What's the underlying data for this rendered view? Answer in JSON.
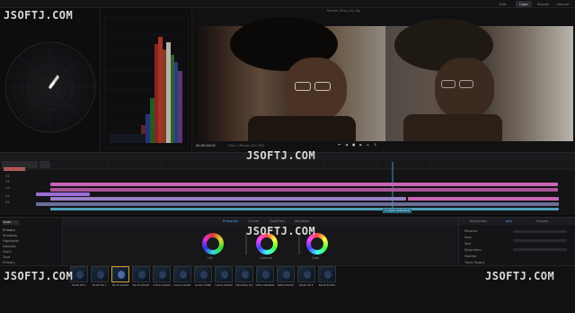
{
  "app": {
    "watermark": "JSOFTJ.COM",
    "pages": [
      "Media",
      "Edit",
      "Color",
      "Render",
      "Deliver"
    ],
    "active_page": "Color"
  },
  "viewer": {
    "clip_label": "Marbie_Silva_04_clip",
    "timecode": "00:00:24:02",
    "zoom_label": "Clip 1",
    "info": "Clip 1 (Prores 422 HQ)"
  },
  "timeline": {
    "track_labels": [
      "V1",
      "V2",
      "V3",
      "A1",
      "A2"
    ],
    "status": "2 clips selected"
  },
  "colorpanel": {
    "tabs": [
      "Primaries",
      "Curves",
      "Qualifiers",
      "Windows"
    ],
    "active_tab": "Primaries",
    "wheel_modes": [
      "Lift",
      "Gamma",
      "Gain"
    ],
    "node_list": [
      "Primary",
      "Shadows",
      "Highlights",
      "Denoise",
      "Grain",
      "Tone",
      "Primary",
      "Output"
    ],
    "right_tabs": [
      "Keyframes",
      "Info",
      "Scopes"
    ],
    "right_active": "Info",
    "right_fields": [
      "Reverse",
      "Solo",
      "Size",
      "Saturation",
      "Feather",
      "Track Object"
    ]
  },
  "thumbnails": [
    {
      "label": "NOIR PN 1"
    },
    {
      "label": "BLUE ED 1"
    },
    {
      "label": "BLUE WARM"
    },
    {
      "label": "BLUE MOVIE"
    },
    {
      "label": "GOLD WARM"
    },
    {
      "label": "GOLD SPORT"
    },
    {
      "label": "GOLD TONE"
    },
    {
      "label": "GOLD WARM"
    },
    {
      "label": "NEUTRAL ED"
    },
    {
      "label": "NEW ORANGE"
    },
    {
      "label": "NEW MOVIE"
    },
    {
      "label": "NOIR PN 2"
    },
    {
      "label": "BLUE EXTRA"
    }
  ]
}
